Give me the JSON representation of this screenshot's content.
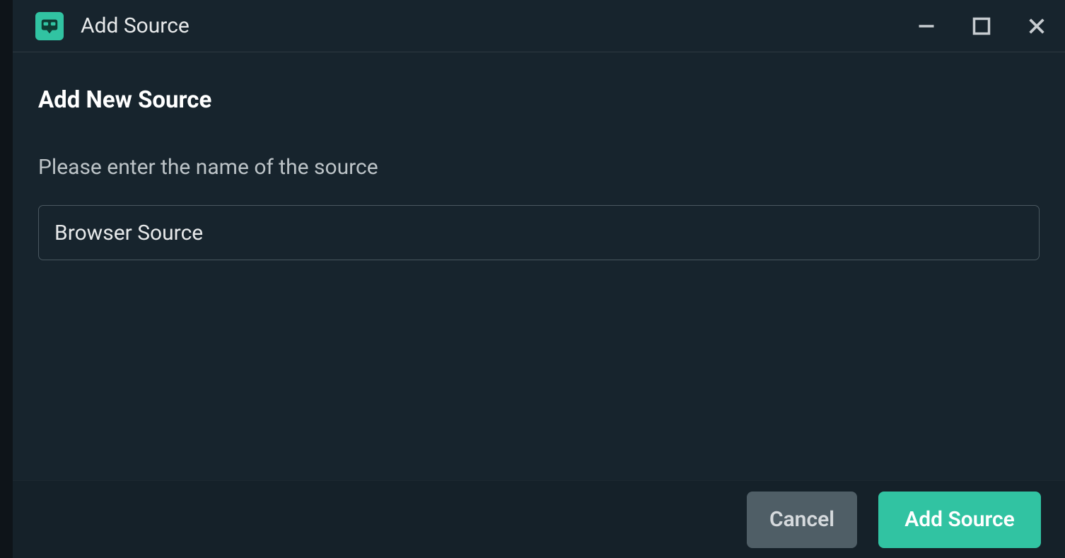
{
  "titlebar": {
    "title": "Add Source"
  },
  "main": {
    "heading": "Add New Source",
    "prompt": "Please enter the name of the source",
    "input_value": "Browser Source"
  },
  "footer": {
    "cancel_label": "Cancel",
    "primary_label": "Add Source"
  },
  "colors": {
    "accent": "#31c3a2",
    "bg": "#17242d"
  }
}
